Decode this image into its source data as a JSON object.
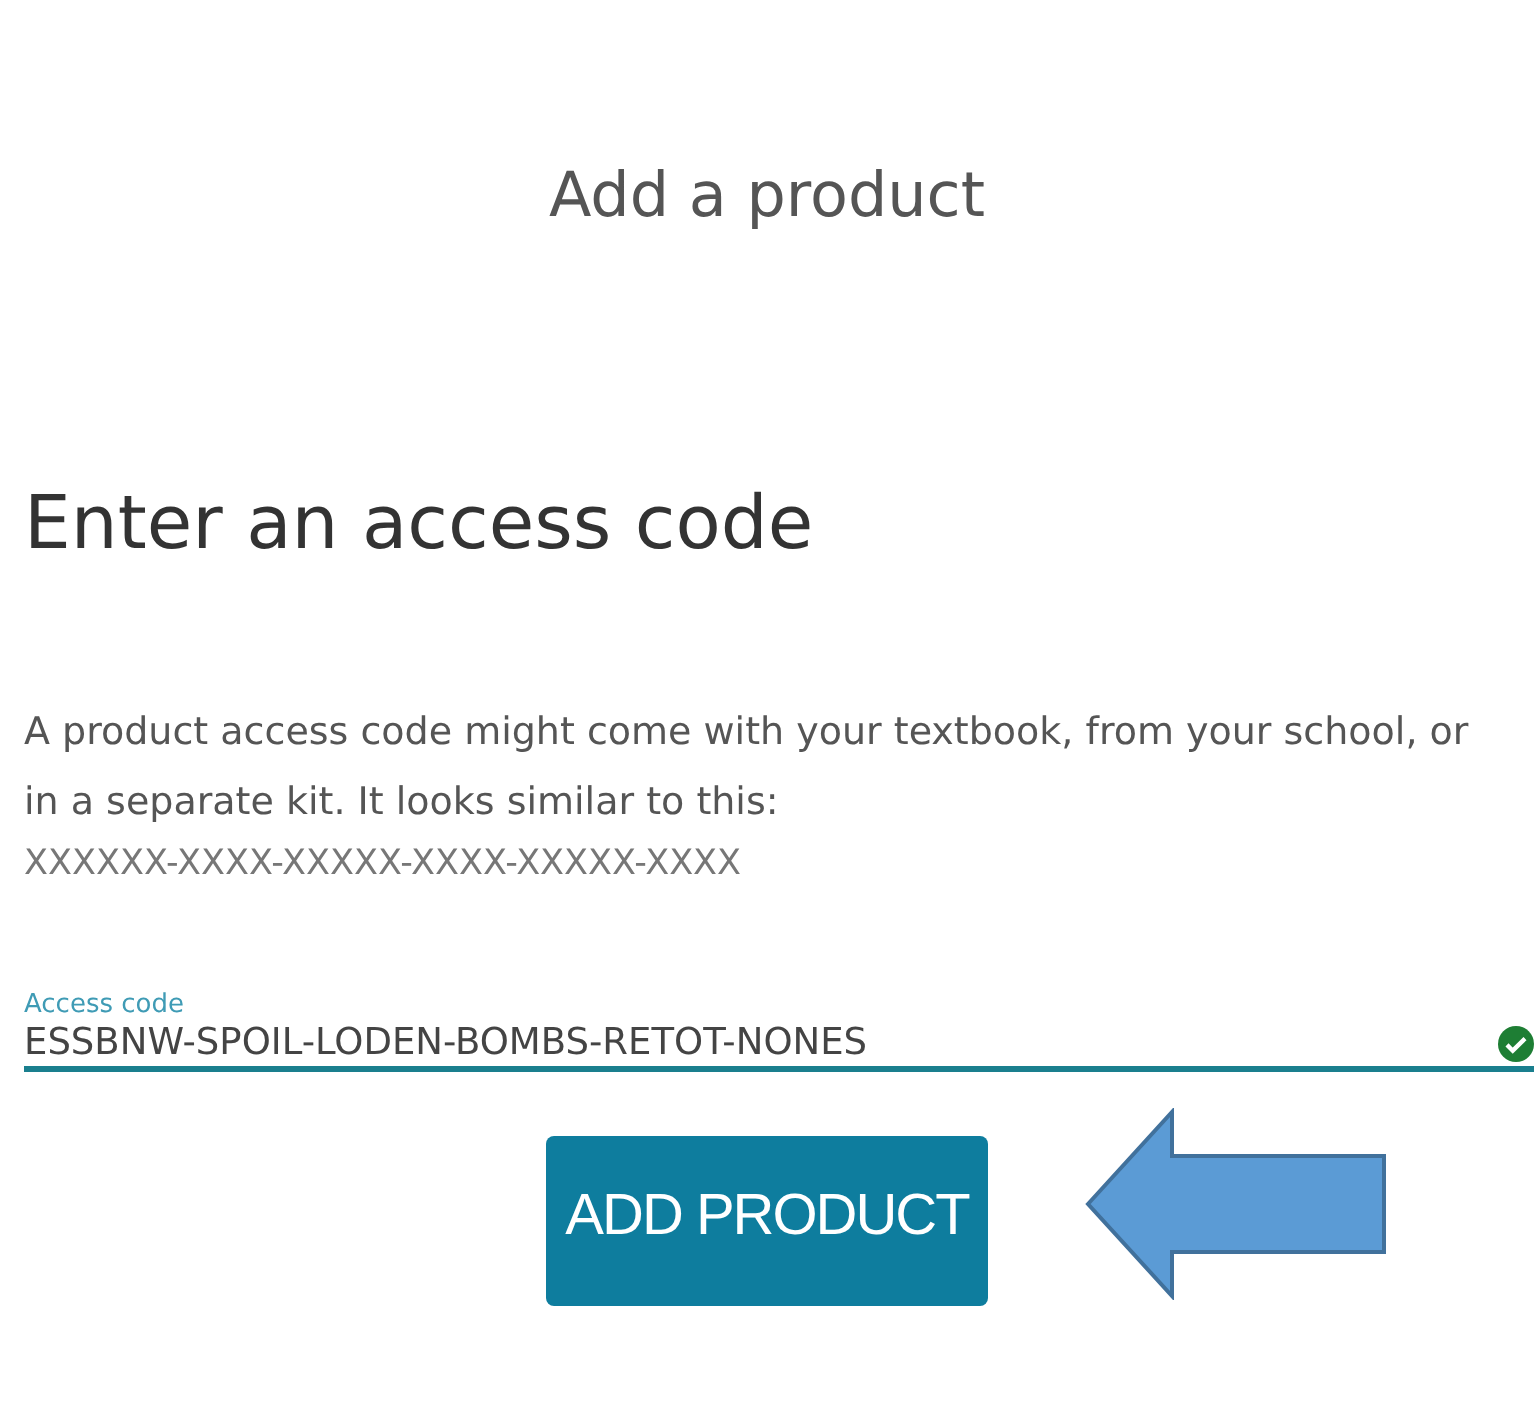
{
  "page_title": "Add a product",
  "heading": "Enter an access code",
  "description": "A product access code might come with your textbook, from your school, or in a separate kit. It looks similar to this:",
  "code_format": "XXXXXX-XXXX-XXXXX-XXXX-XXXXX-XXXX",
  "access_code_field": {
    "label": "Access code",
    "value": "ESSBNW-SPOIL-LODEN-BOMBS-RETOT-NONES",
    "valid": true
  },
  "add_button": {
    "label": "ADD PRODUCT"
  }
}
